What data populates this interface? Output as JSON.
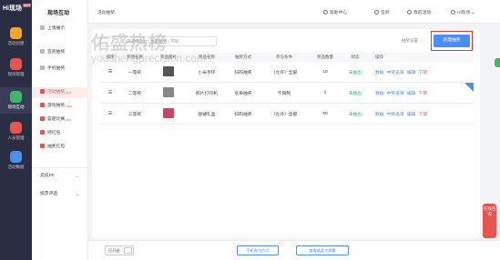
{
  "brand": {
    "name": "Hi现场",
    "tag": "HOT"
  },
  "rail": [
    {
      "label": "活动创建",
      "icon": "calendar-icon",
      "color": "#f5a623"
    },
    {
      "label": "现场管理",
      "icon": "scene-icon",
      "color": "#e8554e"
    },
    {
      "label": "现场互动",
      "icon": "interaction-icon",
      "color": "#3fb86b"
    },
    {
      "label": "人员管理",
      "icon": "people-icon",
      "color": "#e8554e"
    },
    {
      "label": "活动数据",
      "icon": "chart-icon",
      "color": "#4a8ff5"
    }
  ],
  "submenu": {
    "title": "现场互动",
    "items": [
      "上墙展示",
      "签到抽奖",
      "手机抽奖",
      "活动抽奖",
      "游戏抽奖",
      "答题比赛",
      "摇红包",
      "抽奖红包",
      "竞技PK",
      "投票评选"
    ],
    "hot": "HOT",
    "new": "NEW"
  },
  "topbar": {
    "crumb": "活动抽奖",
    "help": "帮助中心",
    "signin": "签到",
    "my_activity": "我的活动",
    "user": "Hi现场"
  },
  "main": {
    "filter_placeholder": "请选择活动 | 全部抽奖 | 不限",
    "secondary_btn": "抽奖设置",
    "primary_btn": "新建抽奖",
    "columns": [
      "排序",
      "奖项名称",
      "奖品图片",
      "奖品名称",
      "抽奖方式",
      "参与条件",
      "奖品数量",
      "状态",
      "操作"
    ],
    "rows": [
      {
        "order": "",
        "award": "一等奖",
        "prize": "小米手环",
        "method": "扫码抽奖",
        "cond": "（允许）全部",
        "qty": "10",
        "status": "未抽出",
        "ops": [
          "数据",
          "中奖名单",
          "编辑",
          "下架"
        ]
      },
      {
        "order": "",
        "award": "二等奖",
        "prize": "照片打印机",
        "method": "名单抽奖",
        "cond": "不限制",
        "qty": "1",
        "status": "未抽出",
        "ops": [
          "数据",
          "中奖名单",
          "编辑",
          "下架"
        ]
      },
      {
        "order": "",
        "award": "三等奖",
        "prize": "围裙礼盒",
        "method": "扫码抽奖",
        "cond": "（允许）全部",
        "qty": "50",
        "status": "未抽出",
        "ops": [
          "数据",
          "中奖名单",
          "编辑",
          "下架"
        ]
      }
    ]
  },
  "bottom": {
    "toggle": "已开启",
    "btn1": "手机参与方式",
    "btn2": "查看抽奖大屏幕"
  },
  "watermark": {
    "cn": "佑盛热榜",
    "url": "youshengprecision.com"
  },
  "float": {
    "label": "在线咨询"
  }
}
